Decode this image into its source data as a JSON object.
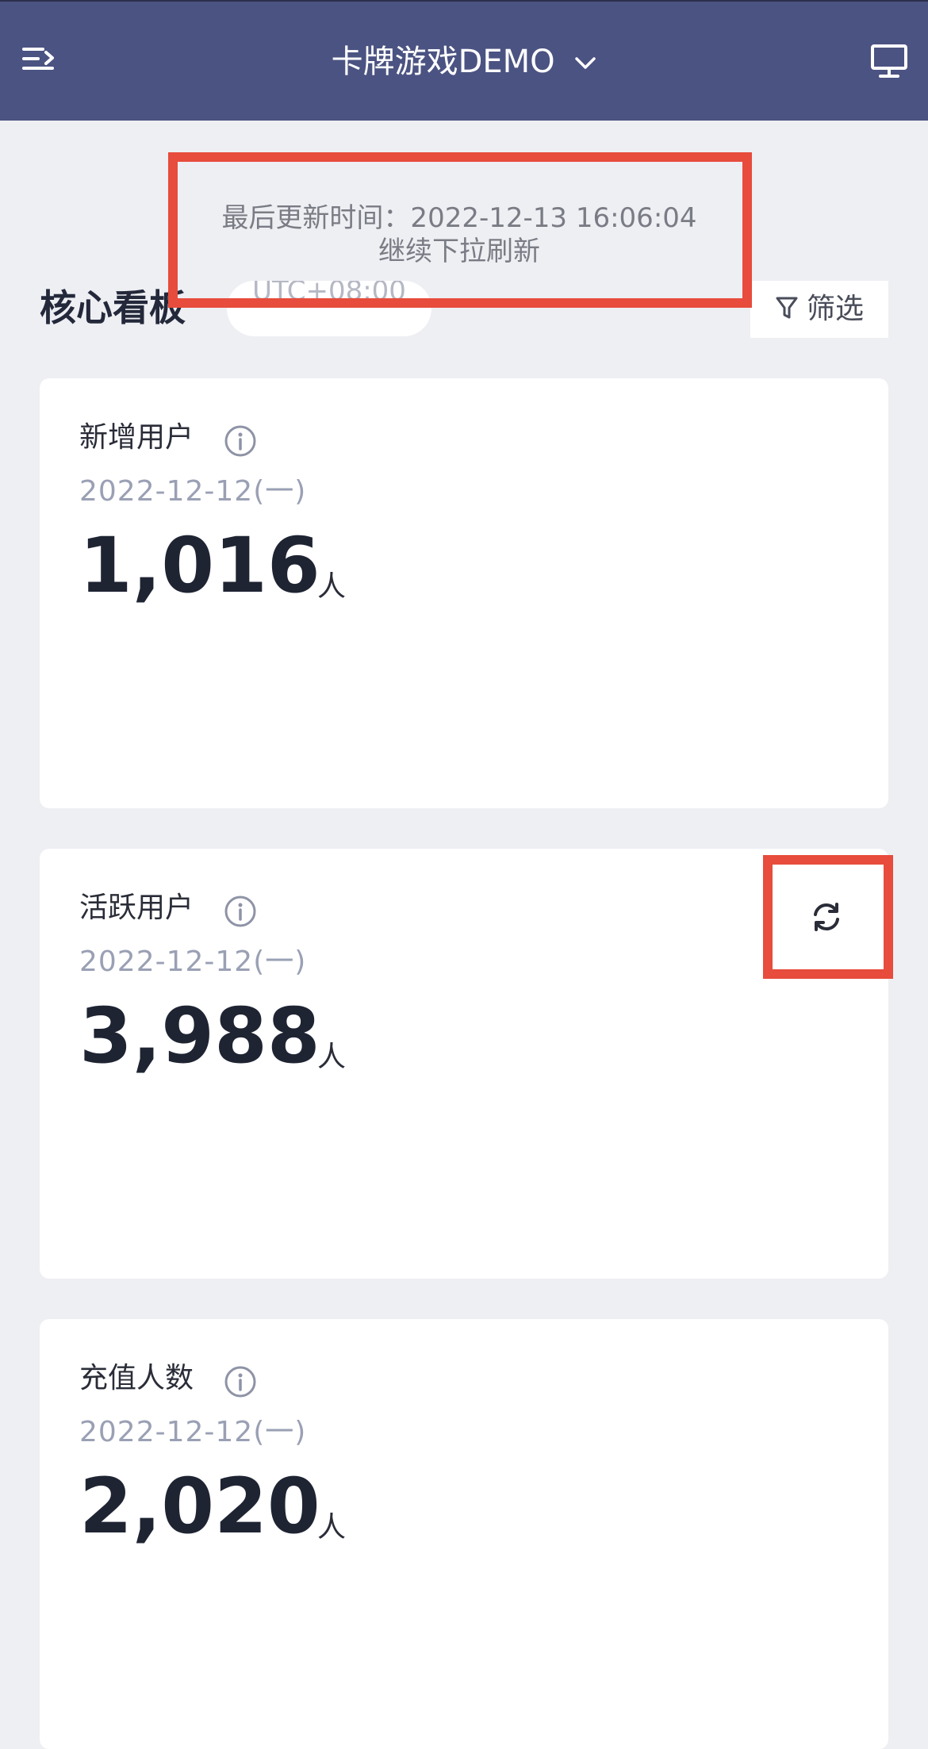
{
  "header": {
    "menu_icon": "menu-collapse-icon",
    "app_title": "卡牌游戏DEMO",
    "dropdown_icon": "chevron-down-icon",
    "monitor_icon": "monitor-icon"
  },
  "refresh_notice": {
    "last_update": "最后更新时间：2022-12-13 16:06:04",
    "pull_hint": "继续下拉刷新"
  },
  "dashboard": {
    "title": "核心看板",
    "timezone": "UTC+08:00",
    "filter_label": "筛选",
    "filter_icon": "filter-icon"
  },
  "cards": [
    {
      "title": "新增用户",
      "date": "2022-12-12(一)",
      "value": "1,016",
      "unit": "人"
    },
    {
      "title": "活跃用户",
      "date": "2022-12-12(一)",
      "value": "3,988",
      "unit": "人",
      "action_icon": "refresh-icon"
    },
    {
      "title": "充值人数",
      "date": "2022-12-12(一)",
      "value": "2,020",
      "unit": "人"
    }
  ],
  "colors": {
    "header_bg": "#4b5382",
    "page_bg": "#eeeff3",
    "highlight": "#e74c3c",
    "value_text": "#1f2433",
    "date_text": "#9aa0b4"
  }
}
